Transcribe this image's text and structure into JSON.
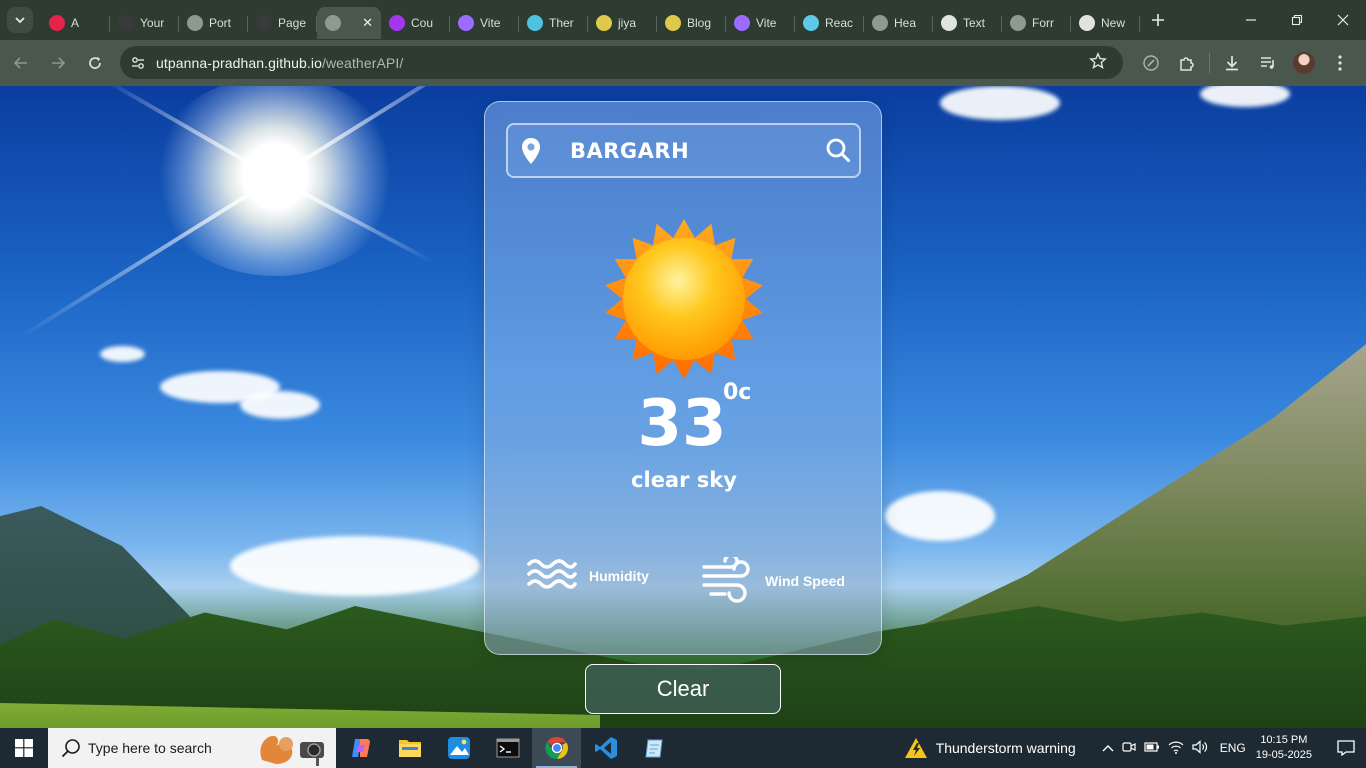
{
  "browser": {
    "tabs": [
      {
        "title": "A",
        "favicon": "youtube-music-icon",
        "color": "#e8234a"
      },
      {
        "title": "Your",
        "favicon": "github-icon",
        "color": "#3a3a3a"
      },
      {
        "title": "Port",
        "favicon": "globe-icon",
        "color": "#8e9a90"
      },
      {
        "title": "Page",
        "favicon": "github-icon",
        "color": "#3a3a3a"
      },
      {
        "title": "",
        "favicon": "globe-icon",
        "color": "#8e9a90",
        "active": true
      },
      {
        "title": "Cou",
        "favicon": "udemy-icon",
        "color": "#a435f0"
      },
      {
        "title": "Vite",
        "favicon": "vite-icon",
        "color": "#9b6cff"
      },
      {
        "title": "Ther",
        "favicon": "blob-icon",
        "color": "#4ec3e0"
      },
      {
        "title": "jiya",
        "favicon": "code-icon",
        "color": "#e0c84a"
      },
      {
        "title": "Blog",
        "favicon": "code-icon",
        "color": "#e0c84a"
      },
      {
        "title": "Vite",
        "favicon": "vite-icon",
        "color": "#9b6cff"
      },
      {
        "title": "Reac",
        "favicon": "react-icon",
        "color": "#5fc8e8"
      },
      {
        "title": "Hea",
        "favicon": "globe-icon",
        "color": "#8e9a90"
      },
      {
        "title": "Text",
        "favicon": "doc-icon",
        "color": "#dfe4df"
      },
      {
        "title": "Forr",
        "favicon": "globe-icon",
        "color": "#8e9a90"
      },
      {
        "title": "New",
        "favicon": "chrome-icon",
        "color": "#dfe4df"
      }
    ],
    "url_host": "utpanna-pradhan.github.io",
    "url_path": "/weatherAPI/"
  },
  "weather": {
    "city": "BARGARH",
    "temperature": "33",
    "unit": "0c",
    "condition": "clear sky",
    "humidity_label": "Humidity",
    "wind_label": "Wind Speed",
    "clear_label": "Clear"
  },
  "taskbar": {
    "search_placeholder": "Type here to search",
    "apps": [
      "copilot-icon",
      "file-explorer-icon",
      "photos-icon",
      "terminal-icon",
      "chrome-icon",
      "vscode-icon",
      "notepad-icon"
    ],
    "active_app": "chrome-icon",
    "weather_warning": "Thunderstorm warning",
    "language": "ENG",
    "time": "10:15 PM",
    "date": "19-05-2025"
  },
  "colors": {
    "tabbar_bg": "#2d3b30",
    "toolbar_bg": "#4a574c",
    "clear_button_bg": "#3e5e52",
    "warning_yellow": "#f5c518"
  }
}
